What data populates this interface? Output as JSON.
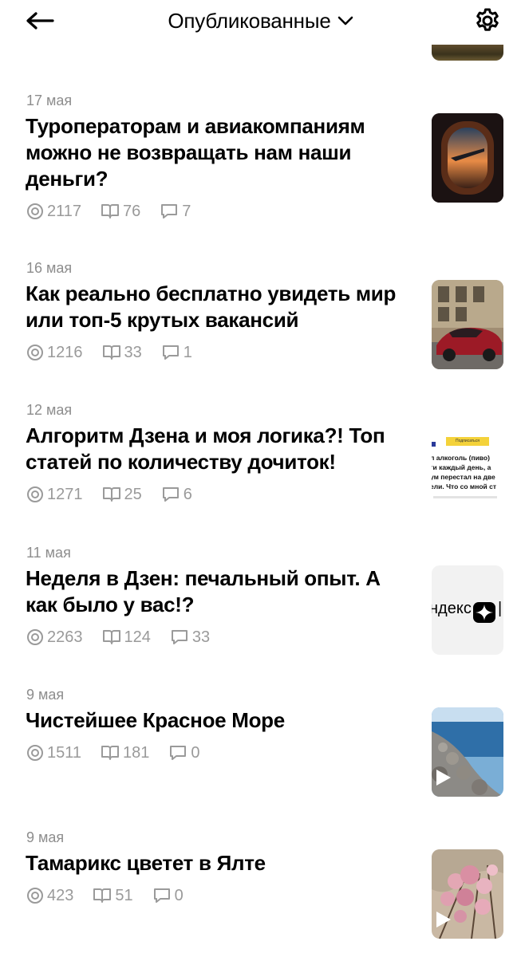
{
  "header": {
    "title": "Опубликованные",
    "back_icon": "arrow-left-icon",
    "dropdown_icon": "chevron-down-icon",
    "settings_icon": "gear-icon"
  },
  "articles": [
    {
      "date": "17 мая",
      "title": "Туроператорам и авиакомпаниям можно не возвращать нам наши деньги?",
      "views": "2117",
      "reads": "76",
      "comments": "7",
      "thumbnail": "airplane-window-image"
    },
    {
      "date": "16 мая",
      "title": "Как реально бесплатно увидеть мир или топ-5 крутых вакансий",
      "views": "1216",
      "reads": "33",
      "comments": "1",
      "thumbnail": "red-car-street-image"
    },
    {
      "date": "12 мая",
      "title": "Алгоритм Дзена и моя логика?! Топ статей по количеству дочиток!",
      "views": "1271",
      "reads": "25",
      "comments": "6",
      "thumbnail": "article-screenshot-image",
      "thumb_text": {
        "button": "Подписаться",
        "line1": "л алкоголь (пиво)",
        "line2": "ги каждый день, а",
        "line3": "ум перестал на две",
        "line4": "ели. Что со мной ст"
      }
    },
    {
      "date": "11 мая",
      "title": "Неделя в Дзен: печальный опыт. А как было у вас!?",
      "views": "2263",
      "reads": "124",
      "comments": "33",
      "thumbnail": "yandex-zen-logo-image",
      "thumb_text": {
        "logo": "ндекс"
      }
    },
    {
      "date": "9 мая",
      "title": "Чистейшее Красное Море",
      "views": "1511",
      "reads": "181",
      "comments": "0",
      "thumbnail": "sea-coast-video-thumbnail"
    },
    {
      "date": "9 мая",
      "title": "Тамарикс цветет в Ялте",
      "views": "423",
      "reads": "51",
      "comments": "0",
      "thumbnail": "tamarisk-flowers-video-thumbnail"
    }
  ],
  "colors": {
    "text": "#000000",
    "muted": "#8d8d8d",
    "background": "#ffffff"
  }
}
